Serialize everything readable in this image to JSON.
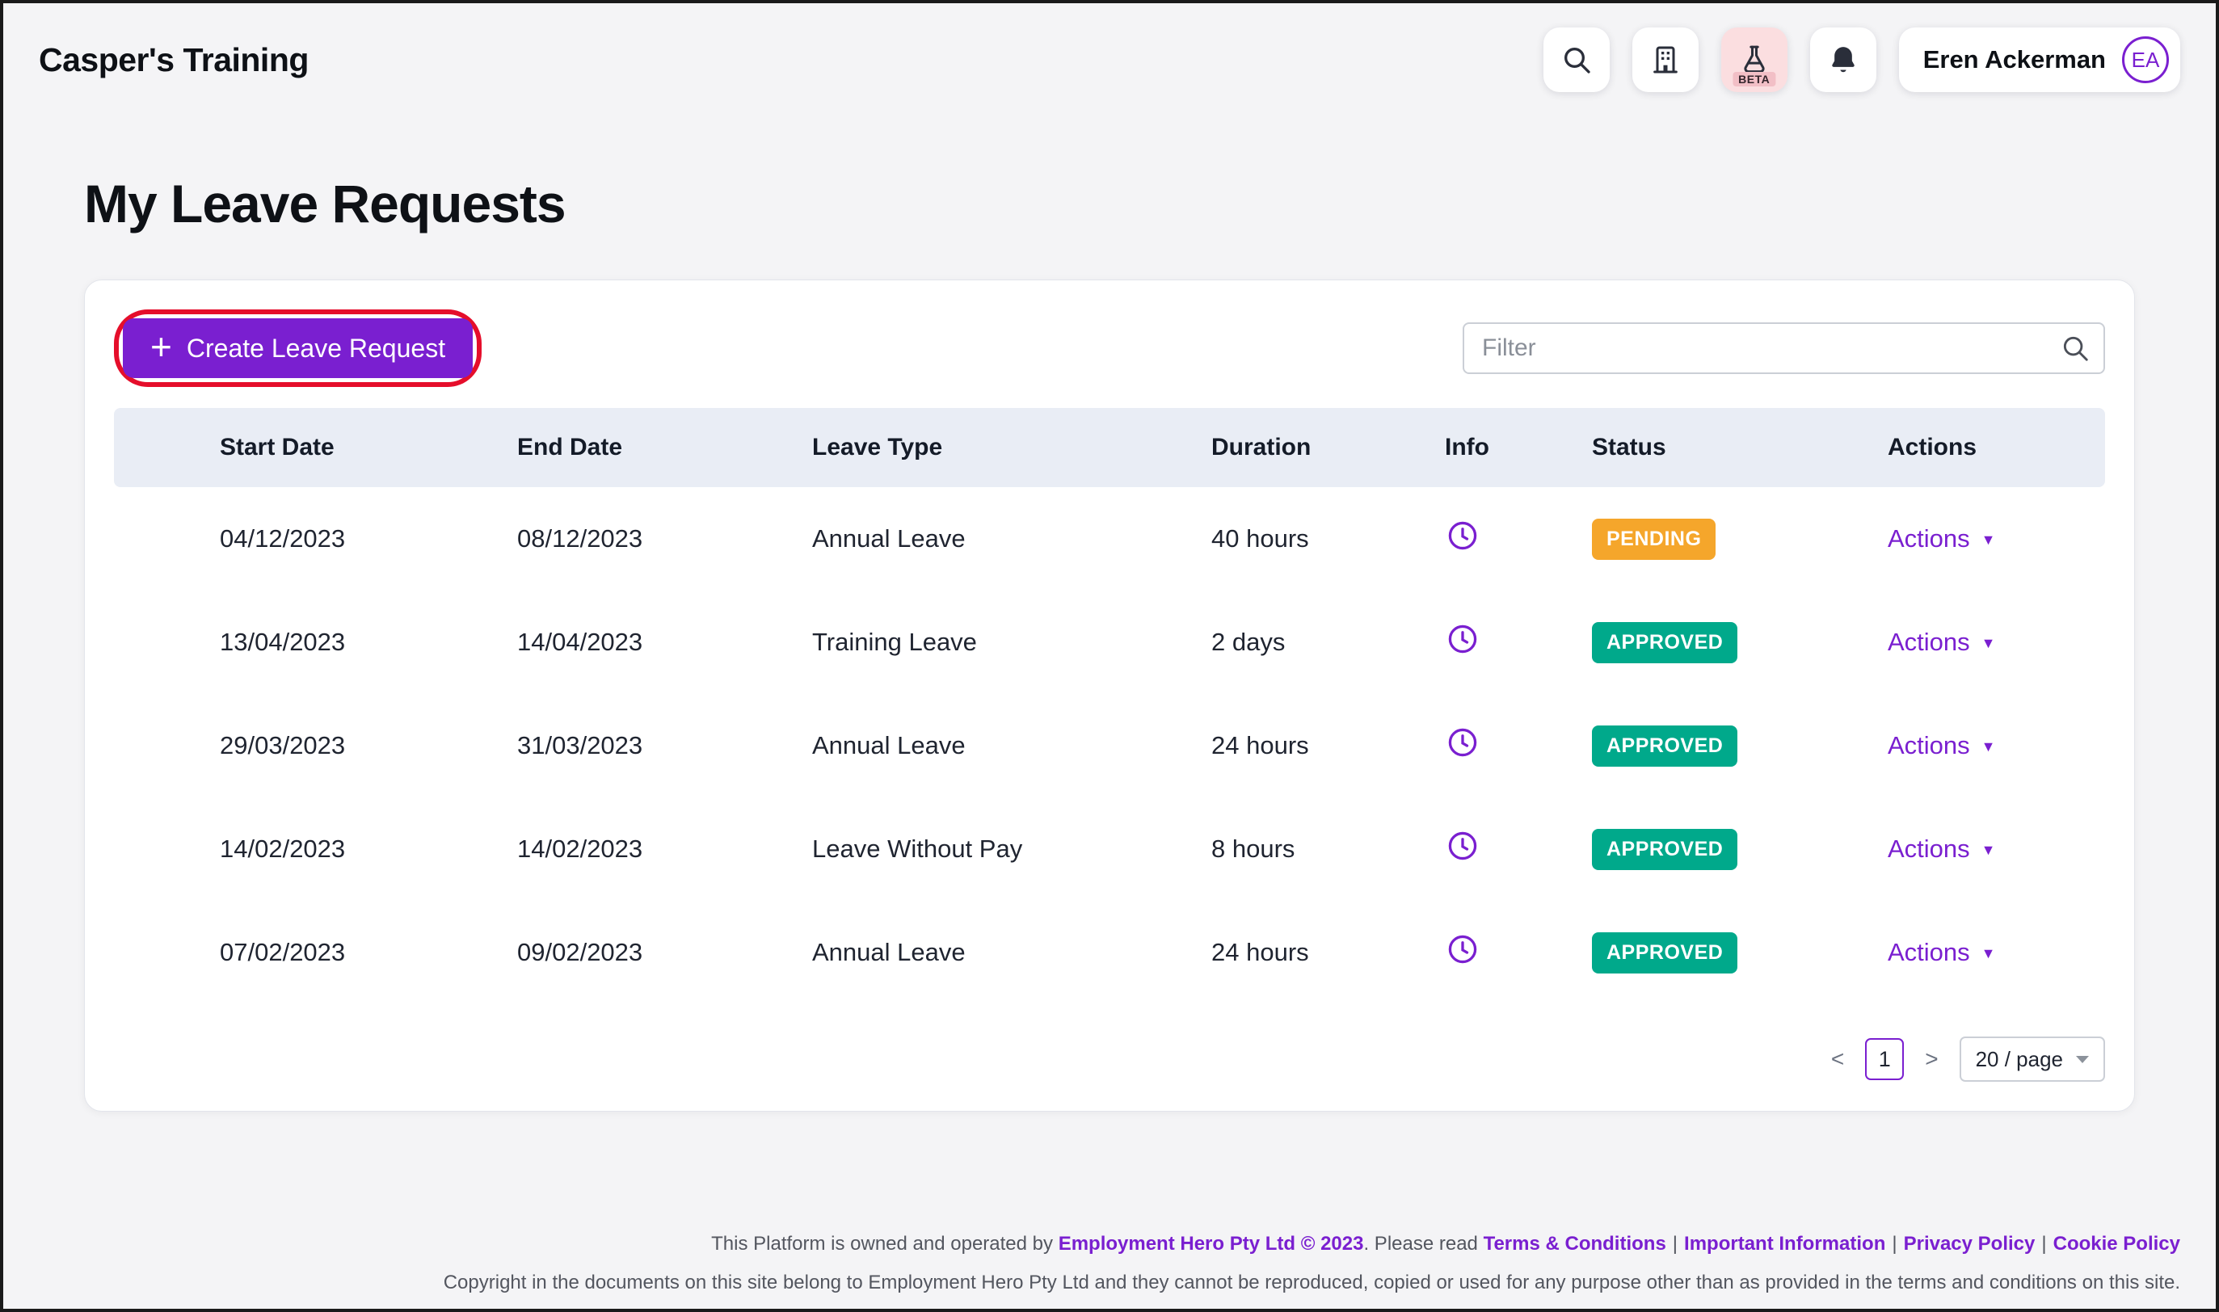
{
  "header": {
    "brand": "Casper's Training",
    "user_name": "Eren Ackerman",
    "user_initials": "EA",
    "beta_label": "BETA"
  },
  "page": {
    "title": "My Leave Requests"
  },
  "toolbar": {
    "create_button": "Create Leave Request",
    "filter_placeholder": "Filter"
  },
  "table": {
    "columns": {
      "start": "Start Date",
      "end": "End Date",
      "type": "Leave Type",
      "duration": "Duration",
      "info": "Info",
      "status": "Status",
      "actions": "Actions"
    },
    "actions_label": "Actions",
    "rows": [
      {
        "start": "04/12/2023",
        "end": "08/12/2023",
        "type": "Annual Leave",
        "duration": "40 hours",
        "status": "PENDING",
        "actions": "Actions"
      },
      {
        "start": "13/04/2023",
        "end": "14/04/2023",
        "type": "Training Leave",
        "duration": "2 days",
        "status": "APPROVED",
        "actions": "Actions"
      },
      {
        "start": "29/03/2023",
        "end": "31/03/2023",
        "type": "Annual Leave",
        "duration": "24 hours",
        "status": "APPROVED",
        "actions": "Actions"
      },
      {
        "start": "14/02/2023",
        "end": "14/02/2023",
        "type": "Leave Without Pay",
        "duration": "8 hours",
        "status": "APPROVED",
        "actions": "Actions"
      },
      {
        "start": "07/02/2023",
        "end": "09/02/2023",
        "type": "Annual Leave",
        "duration": "24 hours",
        "status": "APPROVED",
        "actions": "Actions"
      }
    ]
  },
  "pagination": {
    "prev": "<",
    "page": "1",
    "next": ">",
    "page_size": "20 / page"
  },
  "footer": {
    "line1_text": "This Platform is owned and operated by ",
    "line1_link_company": "Employment Hero Pty Ltd © 2023",
    "line1_mid": ". Please read ",
    "separator": "|",
    "links": {
      "terms": "Terms & Conditions",
      "important": "Important Information",
      "privacy": "Privacy Policy",
      "cookie": "Cookie Policy"
    },
    "line2": "Copyright in the documents on this site belong to Employment Hero Pty Ltd and they cannot be reproduced, copied or used for any purpose other than as provided in the terms and conditions on this site."
  },
  "colors": {
    "accent": "#7A1FD0",
    "pending": "#F5A62B",
    "approved": "#00A98B",
    "highlight_ring": "#E50E2B",
    "table_header_bg": "#E9EDF5"
  }
}
